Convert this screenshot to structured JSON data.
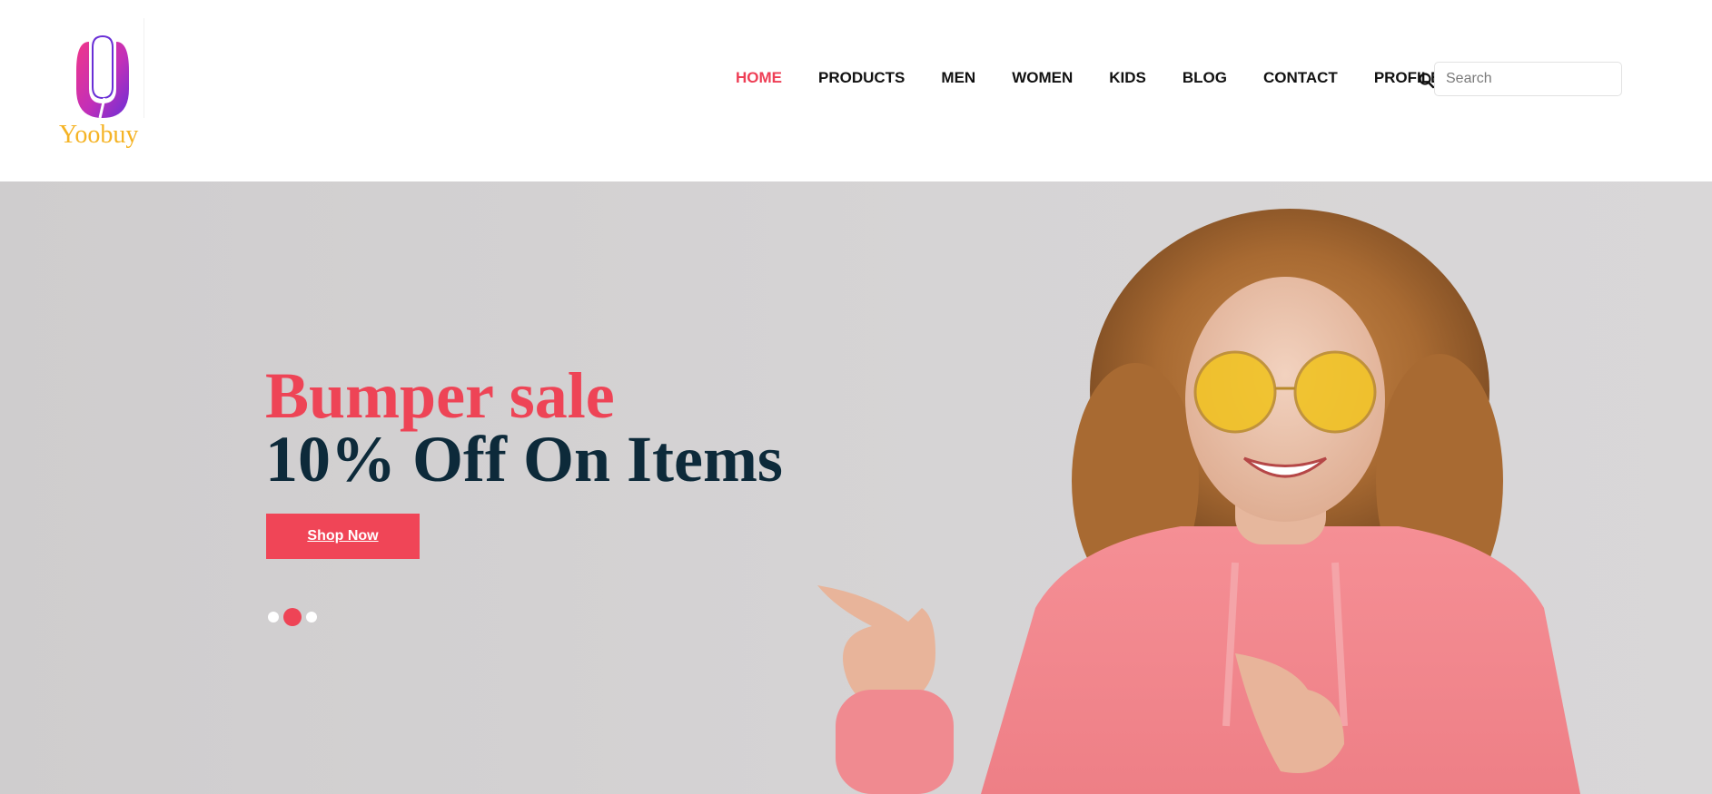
{
  "brand": {
    "name": "Yoobuy",
    "logo_icon": "u-shaped-gradient-logo-icon",
    "colors": {
      "logo_text": "#f5b324",
      "logo_gradient_start": "#f0368a",
      "logo_gradient_end": "#6a2fd6"
    }
  },
  "nav": {
    "items": [
      {
        "label": "HOME",
        "active": true
      },
      {
        "label": "PRODUCTS",
        "active": false
      },
      {
        "label": "MEN",
        "active": false
      },
      {
        "label": "WOMEN",
        "active": false
      },
      {
        "label": "KIDS",
        "active": false
      },
      {
        "label": "BLOG",
        "active": false
      },
      {
        "label": "CONTACT",
        "active": false
      },
      {
        "label": "PROFILE",
        "active": false,
        "dropdown": true
      }
    ],
    "active_color": "#ee3e55"
  },
  "search": {
    "placeholder": "Search",
    "value": "",
    "icon": "search-icon"
  },
  "hero": {
    "headline": "Bumper sale",
    "subhead": "10% Off On Items",
    "cta_label": "Shop Now",
    "slides": {
      "count": 3,
      "active_index": 1
    },
    "photo_icon": "woman-pointing-photo",
    "colors": {
      "headline": "#ee4456",
      "subhead": "#0d2a3a",
      "cta_bg": "#f04557",
      "background": "#d3d1d2"
    }
  }
}
